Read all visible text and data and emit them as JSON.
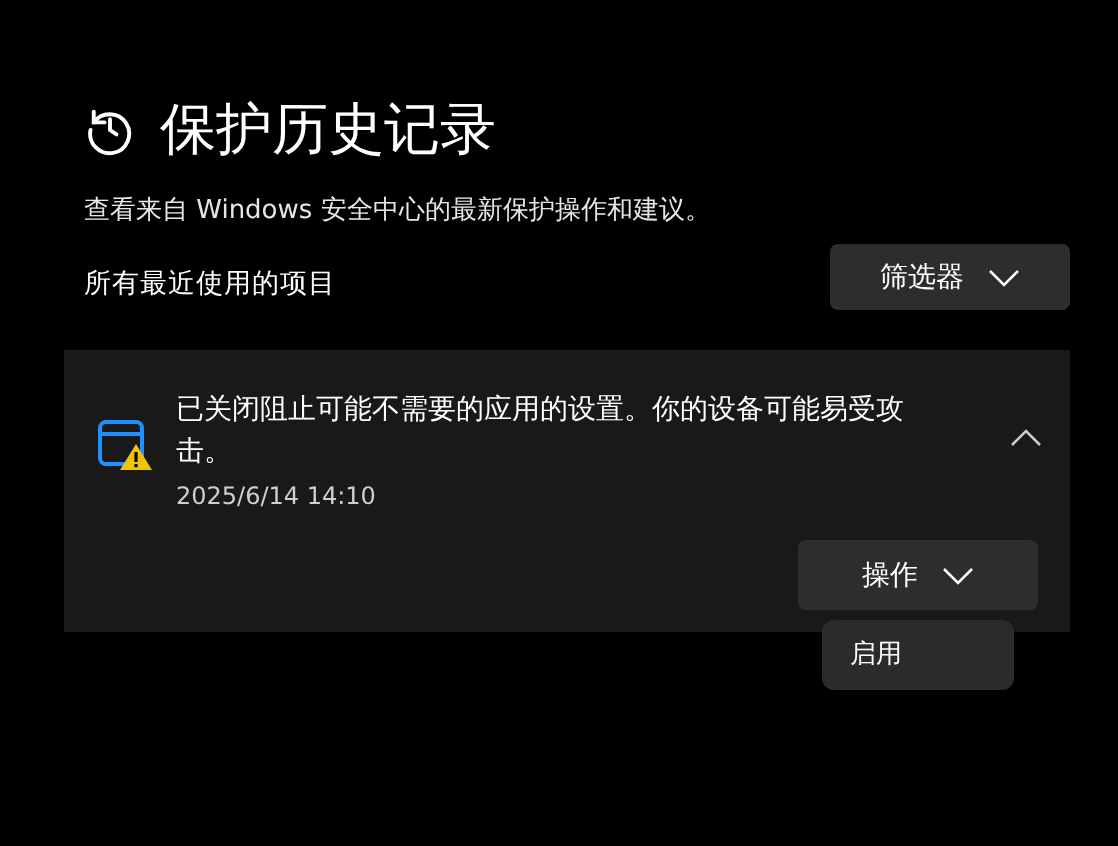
{
  "header": {
    "title": "保护历史记录",
    "subtitle": "查看来自 Windows 安全中心的最新保护操作和建议。"
  },
  "section": {
    "label": "所有最近使用的项目",
    "filter_button": "筛选器"
  },
  "events": [
    {
      "message": "已关闭阻止可能不需要的应用的设置。你的设备可能易受攻击。",
      "time": "2025/6/14 14:10",
      "expanded": true,
      "actions_button": "操作",
      "menu_open": true,
      "menu_items": [
        "启用"
      ]
    }
  ]
}
